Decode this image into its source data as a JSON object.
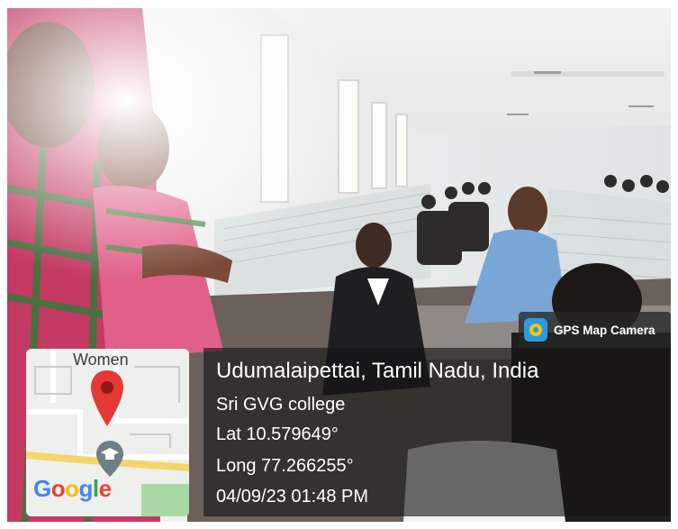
{
  "watermark": {
    "app_badge": "GPS Map Camera",
    "location_title": "Udumalaipettai, Tamil Nadu, India",
    "place_name": "Sri GVG college",
    "latitude": "Lat 10.579649°",
    "longitude": "Long 77.266255°",
    "datetime": "04/09/23 01:48 PM"
  },
  "map_thumbnail": {
    "label": "Women",
    "logo_text": "Google",
    "pin_icon": "map-pin-icon",
    "marker_icon": "graduation-cap-marker-icon"
  },
  "colors": {
    "panel": "#141414",
    "pin_red": "#e53935",
    "road_yellow": "#f3d66b",
    "badge_icon_blue": "#2a9be0"
  }
}
